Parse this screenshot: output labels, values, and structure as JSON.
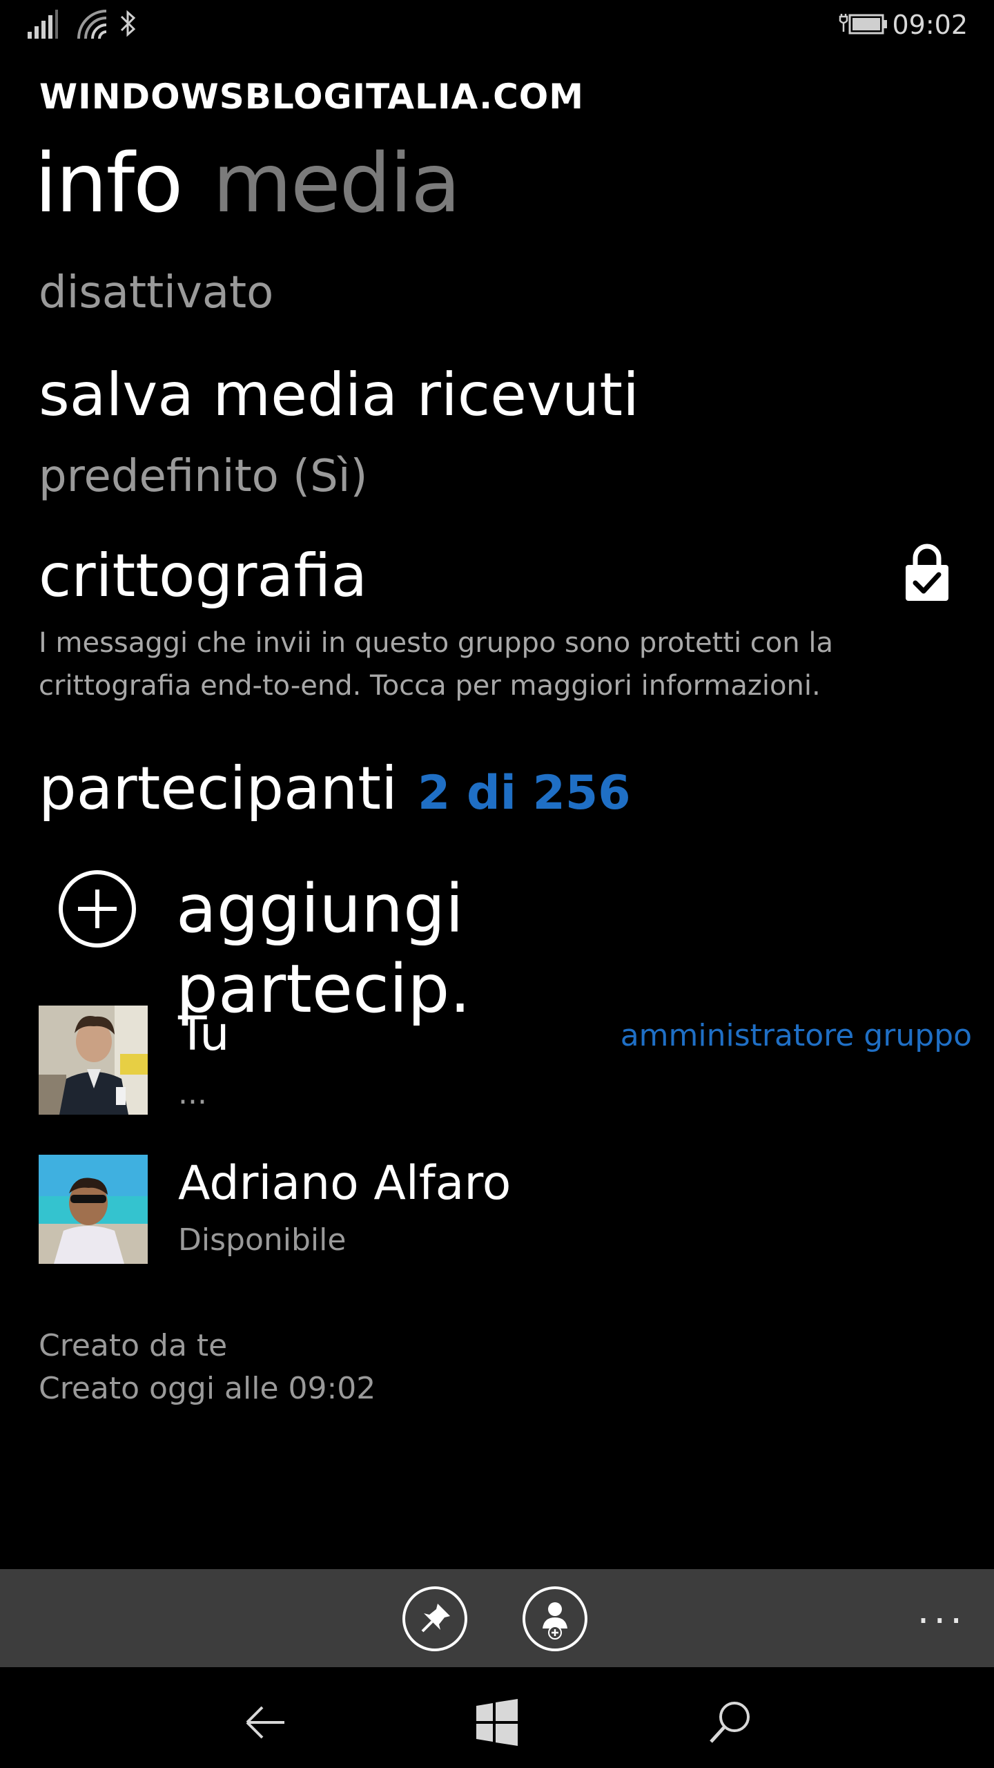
{
  "status_bar": {
    "time": "09:02",
    "icons": [
      "signal-icon",
      "wifi-icon",
      "bluetooth-icon",
      "battery-charging-icon"
    ]
  },
  "app": {
    "title": "WINDOWSBLOGITALIA.COM"
  },
  "pivot": {
    "tabs": [
      {
        "label": "info",
        "active": true
      },
      {
        "label": "media",
        "active": false
      }
    ]
  },
  "settings": {
    "top_value": "disattivato",
    "save_media": {
      "title": "salva media ricevuti",
      "value": "predefinito (Sì)"
    },
    "encryption": {
      "title": "crittografia",
      "line1": "I messaggi che invii in questo gruppo sono protetti con la",
      "line2": "crittografia end-to-end. Tocca per maggiori informazioni.",
      "icon": "lock-check-icon"
    }
  },
  "participants": {
    "title": "partecipanti",
    "count_label": "2 di 256",
    "add_label": "aggiungi partecip.",
    "items": [
      {
        "name": "Tu",
        "status": "...",
        "badge": "amministratore gruppo"
      },
      {
        "name": "Adriano Alfaro",
        "status": "Disponibile",
        "badge": ""
      }
    ]
  },
  "footer": {
    "created_by": "Creato da te",
    "created_at": "Creato oggi alle 09:02"
  },
  "app_bar": {
    "buttons": [
      "pin-icon",
      "add-contact-icon"
    ],
    "more": "..."
  },
  "nav_bar": {
    "buttons": [
      "back-arrow-icon",
      "windows-icon",
      "search-icon"
    ]
  },
  "colors": {
    "accent": "#1f6fc5",
    "background": "#000000",
    "app_bar": "#3d3d3d",
    "secondary_text": "#9a9a9a"
  }
}
